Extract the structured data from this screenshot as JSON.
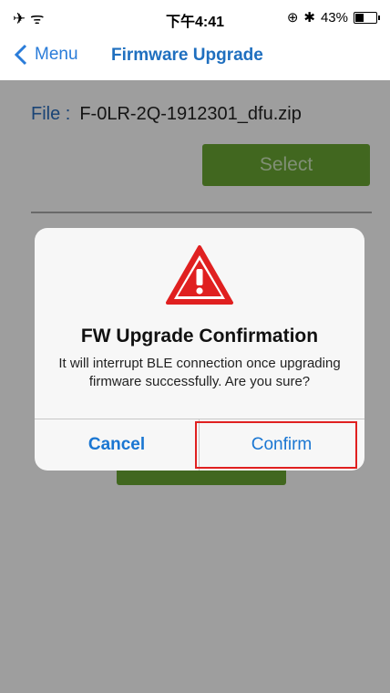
{
  "status_bar": {
    "left_icons": "✈ ᯤ",
    "time": "下午4:41",
    "right_text": "43%",
    "battery_percent": 43
  },
  "nav": {
    "back_label": "Menu",
    "title": "Firmware Upgrade"
  },
  "content": {
    "file_label": "File :",
    "file_name": "F-0LR-2Q-1912301_dfu.zip",
    "select_label": "Select"
  },
  "alert": {
    "icon": "warning-triangle-icon",
    "title": "FW Upgrade Confirmation",
    "message": "It will interrupt BLE connection once upgrading firmware successfully. Are you sure?",
    "cancel_label": "Cancel",
    "confirm_label": "Confirm"
  },
  "colors": {
    "accent": "#1a76d2",
    "button_green": "#6aa632",
    "warning_red": "#e02020",
    "highlight": "#e02020"
  }
}
